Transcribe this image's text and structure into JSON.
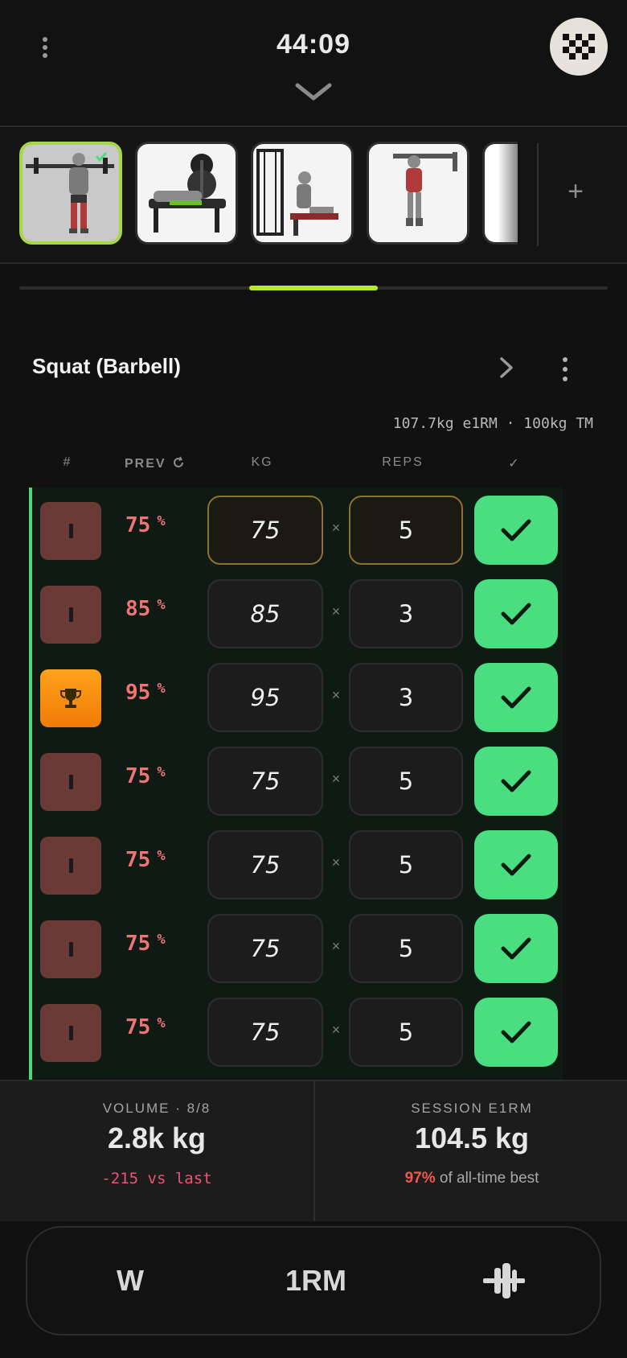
{
  "header": {
    "timer": "44:09",
    "menu_icon": "kebab-vertical-icon",
    "collapse_icon": "chevron-down-icon",
    "finish_icon": "checkered-flag-icon"
  },
  "carousel": {
    "exercises": [
      {
        "name": "Squat (Barbell)",
        "active": true
      },
      {
        "name": "Bench Press",
        "active": false
      },
      {
        "name": "Seated Cable Row",
        "active": false
      },
      {
        "name": "Pull Up",
        "active": false
      },
      {
        "name": "Next exercise",
        "active": false
      }
    ],
    "add_label": "+",
    "page_progress": 0.22
  },
  "exercise": {
    "title": "Squat (Barbell)",
    "stats": "107.7kg e1RM · 100kg TM"
  },
  "columns": {
    "num": "#",
    "prev": "PREV",
    "kg": "KG",
    "reps": "REPS",
    "done": "✓"
  },
  "sets": [
    {
      "type": "normal",
      "prev": "75",
      "pct": "%",
      "kg": "75",
      "times": "×",
      "reps": "5",
      "done": true,
      "active": true
    },
    {
      "type": "normal",
      "prev": "85",
      "pct": "%",
      "kg": "85",
      "times": "×",
      "reps": "3",
      "done": true,
      "active": false
    },
    {
      "type": "pr",
      "prev": "95",
      "pct": "%",
      "kg": "95",
      "times": "×",
      "reps": "3",
      "done": true,
      "active": false
    },
    {
      "type": "normal",
      "prev": "75",
      "pct": "%",
      "kg": "75",
      "times": "×",
      "reps": "5",
      "done": true,
      "active": false
    },
    {
      "type": "normal",
      "prev": "75",
      "pct": "%",
      "kg": "75",
      "times": "×",
      "reps": "5",
      "done": true,
      "active": false
    },
    {
      "type": "normal",
      "prev": "75",
      "pct": "%",
      "kg": "75",
      "times": "×",
      "reps": "5",
      "done": true,
      "active": false
    },
    {
      "type": "normal",
      "prev": "75",
      "pct": "%",
      "kg": "75",
      "times": "×",
      "reps": "5",
      "done": true,
      "active": false
    }
  ],
  "summary": {
    "volume_label": "VOLUME · 8/8",
    "volume_value": "2.8k kg",
    "volume_delta": "-215 vs last",
    "e1rm_label": "SESSION E1RM",
    "e1rm_value": "104.5 kg",
    "e1rm_pct": "97%",
    "e1rm_suffix": " of all-time best"
  },
  "bottom_bar": {
    "warmup_label": "W",
    "onerm_label": "1RM",
    "plates_icon": "barbell-plates-icon"
  },
  "colors": {
    "accent_green": "#4ade80",
    "progress_lime": "#b5ea2c",
    "prev_red": "#f17474",
    "set_badge": "#6b3a36",
    "pr_badge": "#ffa21a"
  }
}
